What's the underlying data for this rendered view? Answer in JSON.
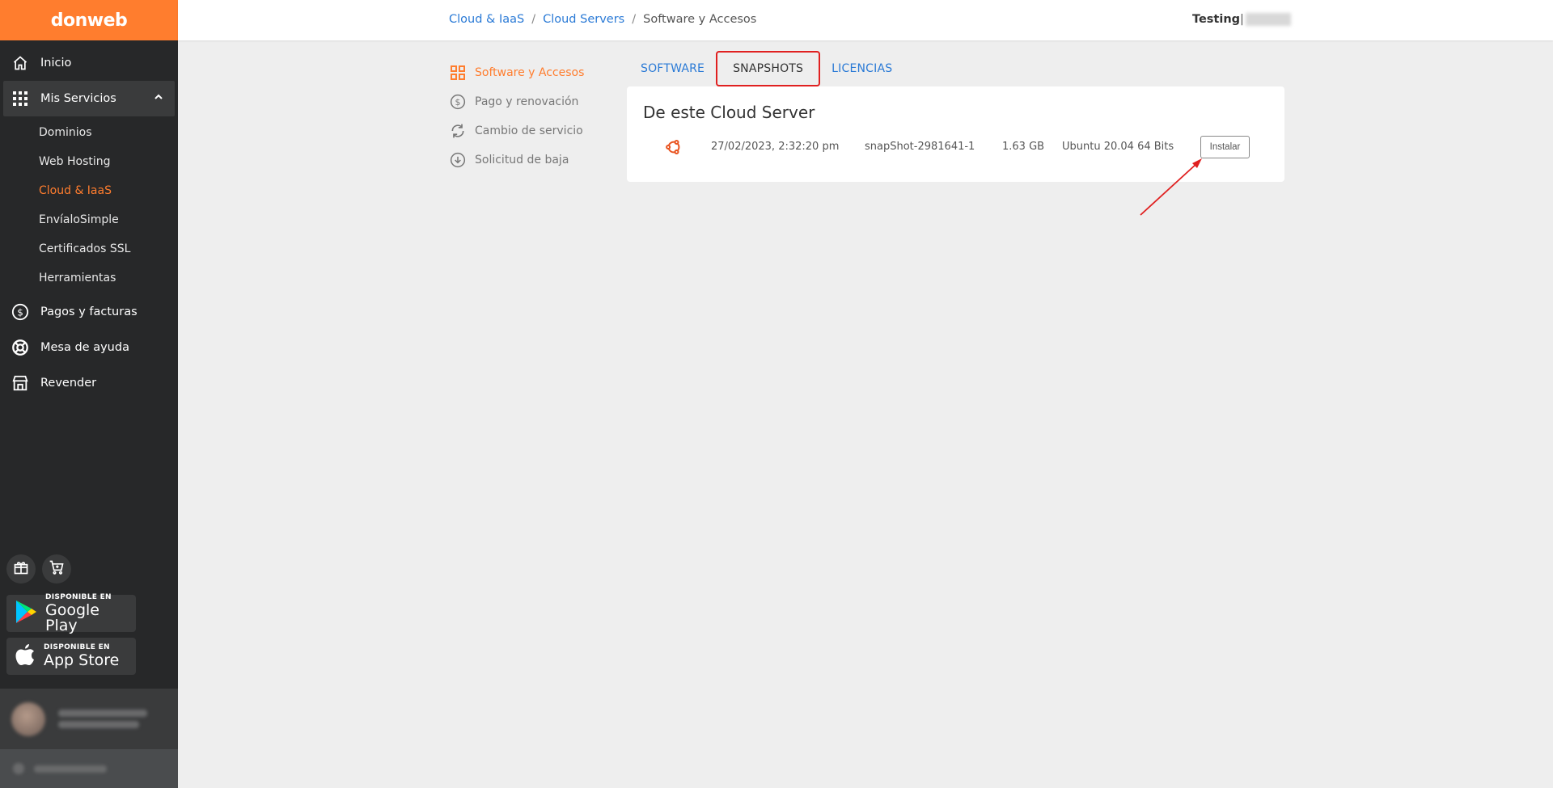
{
  "brand": {
    "logo": "donweb",
    "accent": "#ff7d2e",
    "link": "#2a7ad6",
    "sidebar_bg": "#272829"
  },
  "sidebar": {
    "items": [
      {
        "label": "Inicio",
        "icon": "home-icon"
      },
      {
        "label": "Mis Servicios",
        "icon": "grid-icon",
        "expanded": true
      },
      {
        "label": "Pagos y facturas",
        "icon": "dollar-circle-icon"
      },
      {
        "label": "Mesa de ayuda",
        "icon": "lifebuoy-icon"
      },
      {
        "label": "Revender",
        "icon": "store-icon"
      }
    ],
    "subitems": [
      "Dominios",
      "Web Hosting",
      "Cloud & IaaS",
      "EnvíaloSimple",
      "Certificados SSL",
      "Herramientas"
    ],
    "active_subitem": "Cloud & IaaS",
    "google_play": {
      "small": "DISPONIBLE EN",
      "big": "Google Play"
    },
    "app_store": {
      "small": "DISPONIBLE EN",
      "big": "App Store"
    }
  },
  "header": {
    "breadcrumb": [
      "Cloud & IaaS",
      "Cloud Servers",
      "Software y Accesos"
    ],
    "breadcrumb_sep": "/",
    "user": "Testing"
  },
  "section_menu": [
    {
      "label": "Software y Accesos",
      "icon": "grid-icon",
      "active": true
    },
    {
      "label": "Pago y renovación",
      "icon": "dollar-circle-icon"
    },
    {
      "label": "Cambio de servicio",
      "icon": "refresh-icon"
    },
    {
      "label": "Solicitud de baja",
      "icon": "download-circle-icon"
    }
  ],
  "tabs": [
    {
      "label": "SOFTWARE"
    },
    {
      "label": "SNAPSHOTS",
      "active": true
    },
    {
      "label": "LICENCIAS"
    }
  ],
  "card": {
    "title": "De este Cloud Server",
    "snapshot": {
      "os_icon": "ubuntu-icon",
      "date": "27/02/2023, 2:32:20 pm",
      "name": "snapShot-2981641-1",
      "size": "1.63 GB",
      "os": "Ubuntu 20.04 64 Bits",
      "action": "Instalar"
    }
  }
}
